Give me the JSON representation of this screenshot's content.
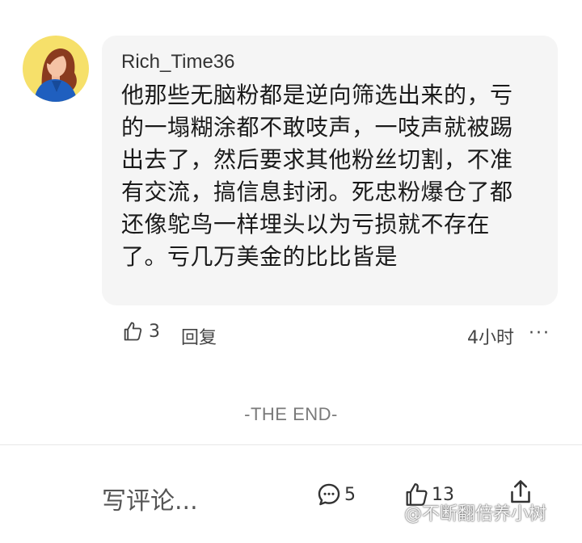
{
  "comment": {
    "username": "Rich_Time36",
    "text": "他那些无脑粉都是逆向筛选出来的，亏\n的一塌糊涂都不敢吱声，一吱声就被踢\n出去了，然后要求其他粉丝切割，不准\n有交流，搞信息封闭。死忠粉爆仓了都\n还像鸵鸟一样埋头以为亏损就不存在\n了。亏几万美金的比比皆是",
    "like_count": "3",
    "reply_label": "回复",
    "time": "4小时",
    "more_label": "···"
  },
  "footer_text": "-THE END-",
  "bottom_bar": {
    "write_comment_placeholder": "写评论...",
    "comment_count": "5",
    "like_count": "13"
  },
  "watermark": "@不断翻倍养小树",
  "icons": {
    "avatar": "avatar",
    "like": "thumbs-up-icon",
    "comment": "comment-bubble-icon",
    "share": "share-icon"
  },
  "colors": {
    "bubble_bg": "#f5f5f5",
    "avatar_bg": "#f6e06a",
    "text": "#1a1a1a",
    "muted": "#7a7a7a"
  }
}
